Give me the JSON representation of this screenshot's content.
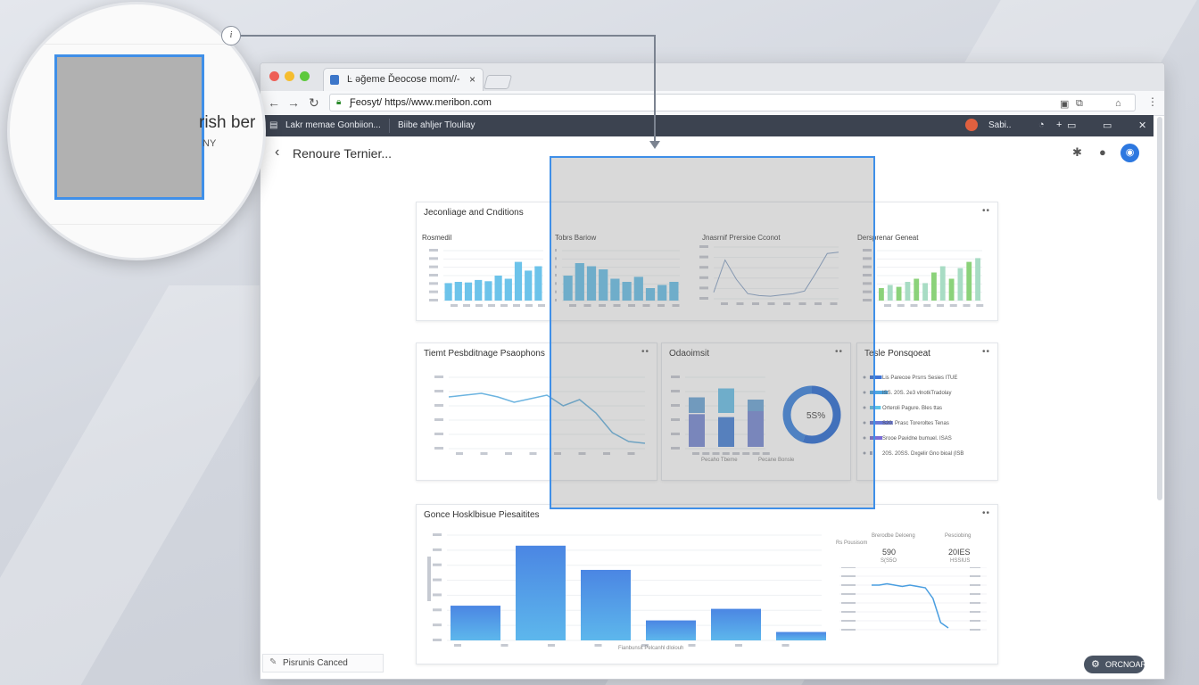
{
  "window": {
    "tab_title": "Ŀ əğeme Ďeocose mom//-",
    "tab_close": "×",
    "url": "Ƒeosyt/ https//www.meribon.com"
  },
  "bookmarks": {
    "item1": "Lakr memae Gonbiion...",
    "item2": "Biibe ahljer Tlouliay",
    "right_label": "Sabi.."
  },
  "header": {
    "title": "Renoure Ternier...",
    "back": "‹"
  },
  "cards": {
    "top": {
      "title": "Jeconliage and Cnditions",
      "sub1": "Rosmedil",
      "sub2": "Tobrs Bariow",
      "sub3": "Jnasrnif Prersioe Cconot",
      "sub4": "Dersprenar Geneat"
    },
    "mid_left": {
      "title": "Tiemt Pesbditnage Psaophons"
    },
    "mid_center": {
      "title": "Odaoimsit",
      "donut_label": "5S%",
      "label1": "Pecaho Tbeme",
      "label2": "Pecane Bonsle"
    },
    "mid_right": {
      "title": "Tesle Ponsqoeat",
      "rows": [
        "Lis Parecoe Prsrrs Sesies ITUE",
        "ISS. 20S. 2e3 vlnotkTradolay",
        "Orteroli Pagure. Bles ttas",
        "S20. Prasc Toreroltes Tenas",
        "Srooe Pavidne bumuel. ISAS",
        "20S. 20SS. Dxgelir Gno bioal (ISB"
      ]
    },
    "bottom": {
      "title": "Gonce Hosklbisue Piesaitites",
      "legend1": "Brerodbe Deloeng",
      "legend2": "Pesciobing",
      "stat1_label": "Rs Pousisom",
      "stat1_value": "590",
      "stat1_sub": "S(S5O",
      "stat2_value": "20IES",
      "stat2_sub": "HSSIUS",
      "xcaption": "Fianbunsit Pelcanhl dloiouh"
    }
  },
  "chart_data": [
    {
      "type": "bar",
      "title": "Rosmedil",
      "values": [
        28,
        30,
        29,
        33,
        31,
        40,
        35,
        62,
        48,
        55
      ]
    },
    {
      "type": "bar",
      "title": "Tobrs Bariow",
      "values": [
        40,
        60,
        55,
        50,
        35,
        30,
        38,
        20,
        25,
        30
      ]
    },
    {
      "type": "line",
      "title": "Jnasrnif Prersioe Cconot",
      "values": [
        10,
        60,
        30,
        8,
        5,
        4,
        6,
        8,
        12,
        40,
        70,
        72
      ]
    },
    {
      "type": "bar",
      "title": "Dersprenar Geneat",
      "values": [
        20,
        25,
        22,
        30,
        35,
        28,
        45,
        55,
        35,
        52,
        62,
        68
      ]
    },
    {
      "type": "line",
      "title": "Tiemt Pesbditnage Psaophons",
      "values": [
        58,
        60,
        62,
        58,
        52,
        56,
        60,
        48,
        55,
        40,
        18,
        8,
        6
      ]
    },
    {
      "type": "bar",
      "title": "Odaoimsit",
      "series": [
        {
          "values": [
            35,
            55,
            30
          ]
        },
        {
          "values": [
            55,
            50,
            60
          ]
        }
      ]
    },
    {
      "type": "pie",
      "title": "Odaoimsit",
      "values": [
        55,
        45
      ]
    },
    {
      "type": "bar",
      "title": "Tesle Ponsqoeat",
      "values": [
        48,
        72,
        44,
        92,
        50,
        10
      ]
    },
    {
      "type": "bar",
      "title": "Gonce Hosklbisue Piesaitites",
      "values": [
        33,
        90,
        67,
        19,
        30,
        8
      ]
    },
    {
      "type": "line",
      "values": [
        40,
        40,
        41,
        40,
        39,
        40,
        39,
        38,
        30,
        12,
        8
      ]
    }
  ],
  "footer": {
    "left_label": "Pisrunis Canced",
    "right_label": "ORCNOAR"
  },
  "magnifier": {
    "text1": "rish ber",
    "text2": "NY",
    "node_label": "i"
  },
  "colors": {
    "accent": "#3f8fe8",
    "bar_light": "#6cc3ea",
    "bar_mid": "#4a84d8",
    "bar_green": "#8bd27a",
    "dark_bar": "#3c4350"
  }
}
